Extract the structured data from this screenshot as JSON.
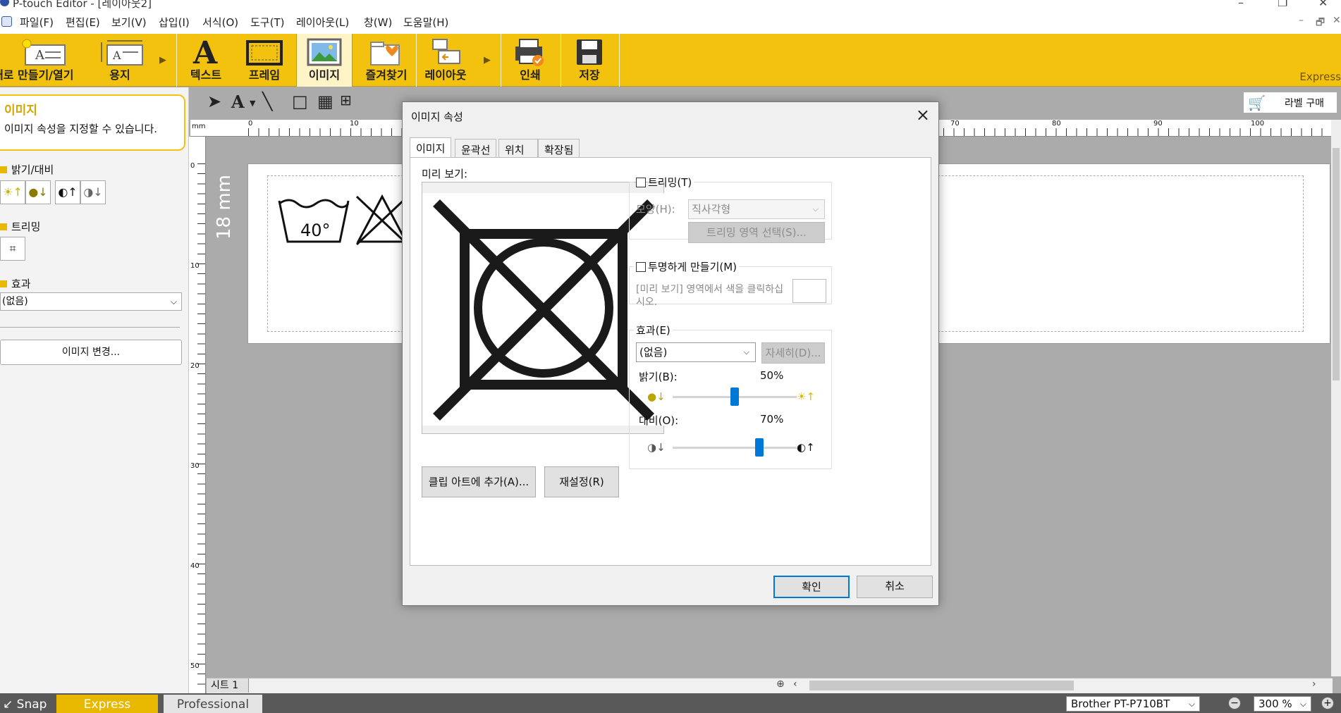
{
  "window": {
    "title": "P-touch Editor - [레이아웃2]",
    "controls": {
      "minimize": "–",
      "restore": "❐",
      "close": "✕"
    }
  },
  "menubar": {
    "items": [
      "파일(F)",
      "편집(E)",
      "보기(V)",
      "삽입(I)",
      "서식(O)",
      "도구(T)",
      "레이아웃(L)",
      "창(W)",
      "도움말(H)"
    ],
    "doc_controls": [
      "–",
      "🗗",
      "✕"
    ]
  },
  "ribbon": {
    "buttons": [
      {
        "label": "새로 만들기/열기",
        "icon": "new-open-icon"
      },
      {
        "label": "용지",
        "icon": "paper-icon"
      },
      {
        "label": "텍스트",
        "icon": "text-icon"
      },
      {
        "label": "프레임",
        "icon": "frame-icon"
      },
      {
        "label": "이미지",
        "icon": "image-icon",
        "active": true
      },
      {
        "label": "즐겨찾기",
        "icon": "favorites-icon"
      },
      {
        "label": "레이아웃",
        "icon": "layout-icon"
      },
      {
        "label": "인쇄",
        "icon": "print-icon"
      },
      {
        "label": "저장",
        "icon": "save-icon"
      }
    ],
    "mode_label": "Express",
    "accent_color": "#f2c20f"
  },
  "toolbar": {
    "buy_label": "라벨 구매"
  },
  "left_panel": {
    "title": "이미지",
    "description": "이미지 속성을 지정할 수 있습니다.",
    "brightness_section": "밝기/대비",
    "trimming_section": "트리밍",
    "effect_section": "효과",
    "effect_value": "(없음)",
    "change_image_button": "이미지 변경..."
  },
  "workspace": {
    "ruler_unit": "mm",
    "top_ruler_ticks": [
      "0",
      "10",
      "70",
      "80",
      "90",
      "100"
    ],
    "left_ruler_ticks": [
      "0",
      "10",
      "20",
      "30",
      "40",
      "50"
    ],
    "label_height": "18 mm",
    "wash_temp": "40°",
    "sheet_tab": "시트 1"
  },
  "dialog": {
    "title": "이미지 속성",
    "tabs": [
      "이미지",
      "윤곽선",
      "위치",
      "확장됨"
    ],
    "active_tab": "이미지",
    "preview_label": "미리 보기:",
    "add_clipart_button": "클립 아트에 추가(A)...",
    "reset_button": "재설정(R)",
    "trimming": {
      "checkbox_label": "트리밍(T)",
      "checked": false,
      "shape_label": "모양(H):",
      "shape_value": "직사각형",
      "select_area_button": "트리밍 영역 선택(S)..."
    },
    "transparent": {
      "checkbox_label": "투명하게 만들기(M)",
      "checked": false,
      "hint": "[미리 보기] 영역에서 색을 클릭하십시오."
    },
    "effect": {
      "group_label": "효과(E)",
      "value": "(없음)",
      "detail_button": "자세히(D)...",
      "brightness_label": "밝기(B):",
      "brightness_value": "50%",
      "brightness_level": 50,
      "contrast_label": "대비(O):",
      "contrast_value": "70%",
      "contrast_level": 70
    },
    "ok_button": "확인",
    "cancel_button": "취소"
  },
  "statusbar": {
    "modes": [
      "Snap",
      "Express",
      "Professional"
    ],
    "active_mode": "Express",
    "printer": "Brother PT-P710BT",
    "zoom": "300 %"
  }
}
